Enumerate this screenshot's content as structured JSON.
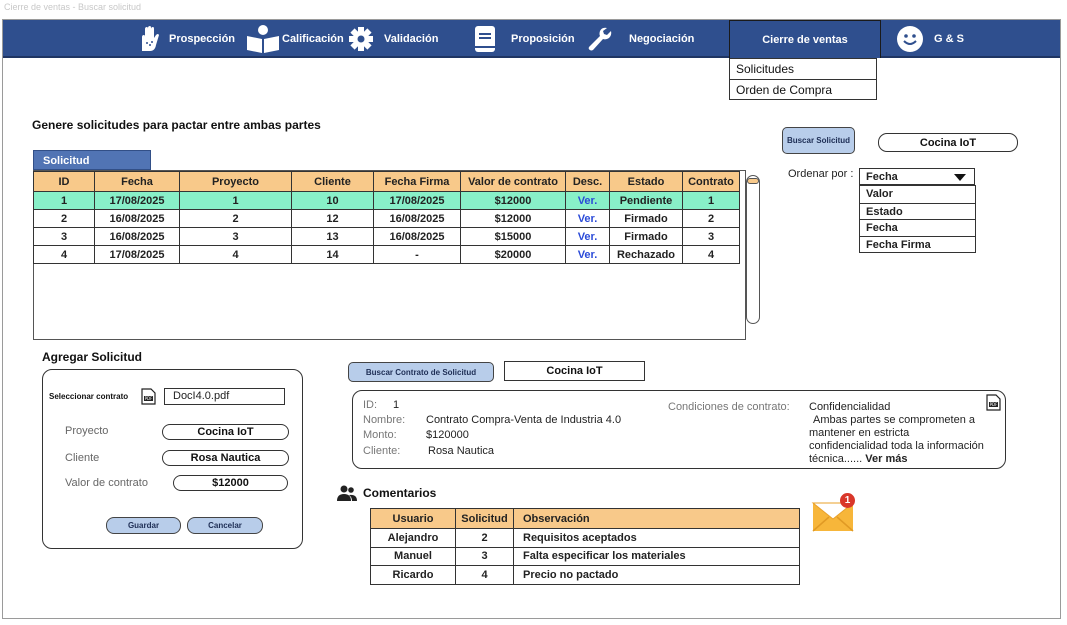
{
  "window": {
    "title": "Cierre de ventas - Buscar solicitud"
  },
  "nav": {
    "items": [
      {
        "label": "Prospección",
        "icon": "hand-icon"
      },
      {
        "label": "Calificación",
        "icon": "reader-icon"
      },
      {
        "label": "Validación",
        "icon": "gear-icon"
      },
      {
        "label": "Proposición",
        "icon": "book-icon"
      },
      {
        "label": "Negociación",
        "icon": "wrench-icon"
      },
      {
        "label": "Cierre de ventas",
        "icon": ""
      }
    ],
    "user": {
      "label": "G & S",
      "icon": "smiley-icon"
    },
    "submenu": [
      "Solicitudes",
      "Orden de Compra"
    ]
  },
  "main": {
    "heading": "Genere solicitudes para pactar entre ambas partes",
    "tab_label": "Solicitud",
    "columns": [
      "ID",
      "Fecha",
      "Proyecto",
      "Cliente",
      "Fecha Firma",
      "Valor de contrato",
      "Desc.",
      "Estado",
      "Contrato"
    ],
    "rows": [
      {
        "id": "1",
        "fecha": "17/08/2025",
        "proyecto": "1",
        "cliente": "10",
        "fecha_firma": "17/08/2025",
        "valor": "$12000",
        "desc": "Ver.",
        "estado": "Pendiente",
        "contrato": "1"
      },
      {
        "id": "2",
        "fecha": "16/08/2025",
        "proyecto": "2",
        "cliente": "12",
        "fecha_firma": "16/08/2025",
        "valor": "$12000",
        "desc": "Ver.",
        "estado": "Firmado",
        "contrato": "2"
      },
      {
        "id": "3",
        "fecha": "16/08/2025",
        "proyecto": "3",
        "cliente": "13",
        "fecha_firma": "16/08/2025",
        "valor": "$15000",
        "desc": "Ver.",
        "estado": "Firmado",
        "contrato": "3"
      },
      {
        "id": "4",
        "fecha": "17/08/2025",
        "proyecto": "4",
        "cliente": "14",
        "fecha_firma": "-",
        "valor": "$20000",
        "desc": "Ver.",
        "estado": "Rechazado",
        "contrato": "4"
      }
    ]
  },
  "search": {
    "button_label": "Buscar Solicitud",
    "value": "Cocina IoT",
    "order_label": "Ordenar por :",
    "order_selected": "Fecha",
    "order_options": [
      "Valor",
      "Estado",
      "Fecha",
      "Fecha Firma"
    ]
  },
  "add_form": {
    "heading": "Agregar Solicitud",
    "select_contract_label": "Seleccionar contrato",
    "file_name": "DocI4.0.pdf",
    "proyecto_label": "Proyecto",
    "proyecto_value": "Cocina IoT",
    "cliente_label": "Cliente",
    "cliente_value": "Rosa Nautica",
    "valor_label": "Valor de contrato",
    "valor_value": "$12000",
    "save_label": "Guardar",
    "cancel_label": "Cancelar"
  },
  "contract_search": {
    "button_label": "Buscar Contrato de Solicitud",
    "value": "Cocina IoT"
  },
  "contract": {
    "id_label": "ID:",
    "id_value": "1",
    "name_label": "Nombre:",
    "name_value": "Contrato Compra-Venta de Industria 4.0",
    "amount_label": "Monto:",
    "amount_value": "$120000",
    "client_label": "Cliente:",
    "client_value": "Rosa Nautica",
    "conditions_label": "Condiciones de contrato:",
    "conditions_title": "Confidencialidad",
    "conditions_text_1": "Ambas partes se comprometen a",
    "conditions_text_2": "mantener en estricta",
    "conditions_text_3": "confidencialidad toda la información",
    "conditions_text_4": "técnica......",
    "see_more": "Ver más"
  },
  "comments": {
    "heading": "Comentarios",
    "columns": [
      "Usuario",
      "Solicitud",
      "Observación"
    ],
    "rows": [
      {
        "usuario": "Alejandro",
        "solicitud": "2",
        "observacion": "Requisitos aceptados"
      },
      {
        "usuario": "Manuel",
        "solicitud": "3",
        "observacion": "Falta especificar los materiales"
      },
      {
        "usuario": "Ricardo",
        "solicitud": "4",
        "observacion": "Precio no pactado"
      }
    ],
    "notification_count": "1"
  },
  "colors": {
    "nav": "#2f4f8e",
    "header_orange": "#f8c98a",
    "selected_row": "#88f0c8",
    "button_blue": "#b8cdea",
    "link": "#2b4bd8"
  }
}
